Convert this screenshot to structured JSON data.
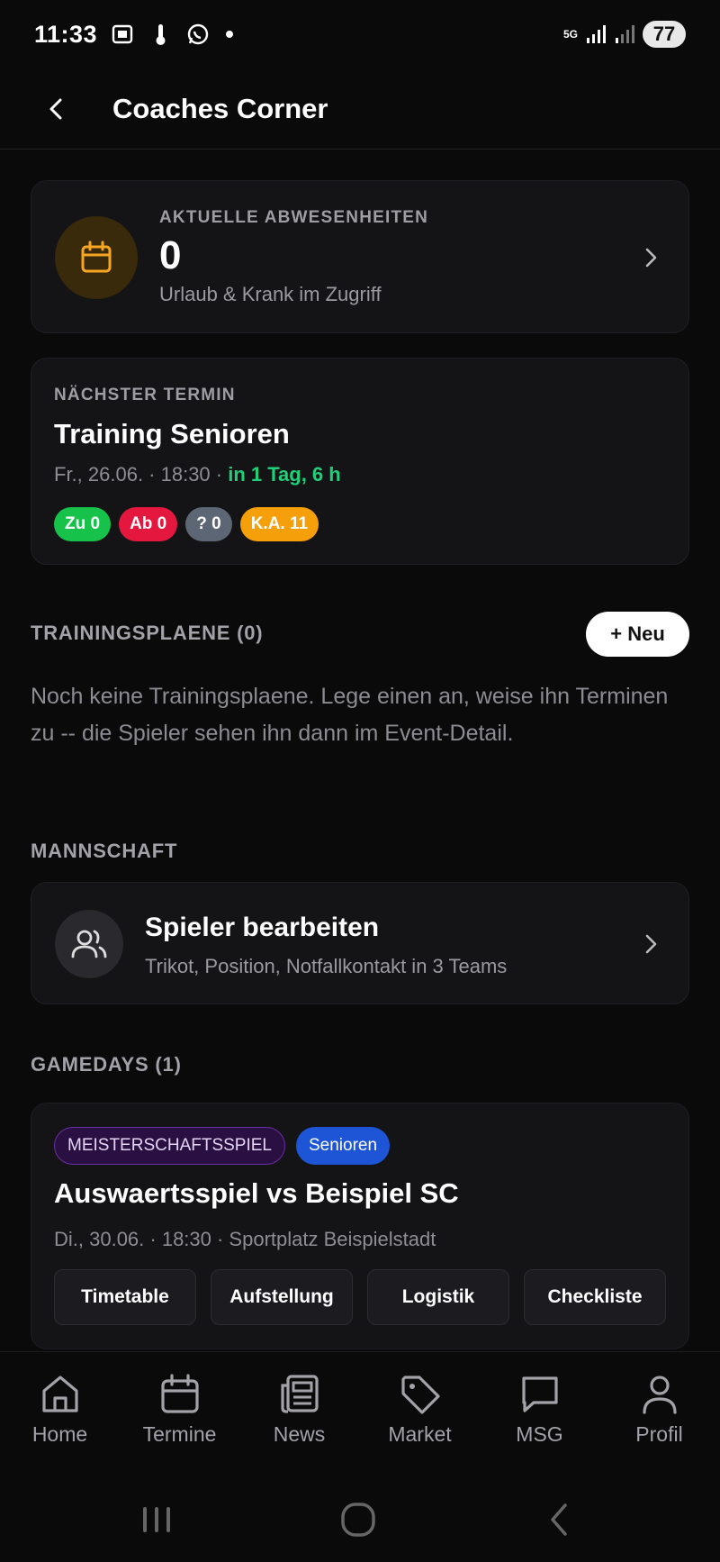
{
  "status_bar": {
    "time": "11:33",
    "battery": "77",
    "network": "5G"
  },
  "header": {
    "title": "Coaches Corner"
  },
  "absence_card": {
    "label": "AKTUELLE ABWESENHEITEN",
    "count": "0",
    "subtitle": "Urlaub & Krank im Zugriff"
  },
  "next_event": {
    "label": "NÄCHSTER TERMIN",
    "title": "Training Senioren",
    "date_time": "Fr., 26.06. · 18:30 · ",
    "countdown": "in 1 Tag, 6 h",
    "badges": [
      {
        "text": "Zu 0",
        "color": "#16c249"
      },
      {
        "text": "Ab 0",
        "color": "#e4173f"
      },
      {
        "text": "? 0",
        "color": "#5d6674"
      },
      {
        "text": "K.A. 11",
        "color": "#f59f0a"
      }
    ]
  },
  "training_plans": {
    "section_label": "TRAININGSPLAENE (0)",
    "new_button": "+ Neu",
    "empty_text": "Noch keine Trainingsplaene. Lege einen an, weise ihn Terminen zu -- die Spieler sehen ihn dann im Event-Detail."
  },
  "team": {
    "section_label": "MANNSCHAFT",
    "title": "Spieler bearbeiten",
    "subtitle": "Trikot, Position, Notfallkontakt in 3 Teams"
  },
  "gamedays": {
    "section_label": "GAMEDAYS (1)",
    "tags": [
      "MEISTERSCHAFTSSPIEL",
      "Senioren"
    ],
    "title": "Auswaertsspiel vs Beispiel SC",
    "meta": "Di., 30.06. · 18:30 · Sportplatz Beispielstadt",
    "actions": [
      "Timetable",
      "Aufstellung",
      "Logistik",
      "Checkliste"
    ]
  },
  "bottom_nav": [
    {
      "label": "Home",
      "icon": "home-icon"
    },
    {
      "label": "Termine",
      "icon": "calendar-icon"
    },
    {
      "label": "News",
      "icon": "newspaper-icon"
    },
    {
      "label": "Market",
      "icon": "tag-icon"
    },
    {
      "label": "MSG",
      "icon": "message-icon"
    },
    {
      "label": "Profil",
      "icon": "user-icon"
    }
  ],
  "colors": {
    "accent_green": "#1fcf7a",
    "calendar_icon": "#f5a623",
    "background": "#0a0a0b",
    "card": "#141416"
  }
}
